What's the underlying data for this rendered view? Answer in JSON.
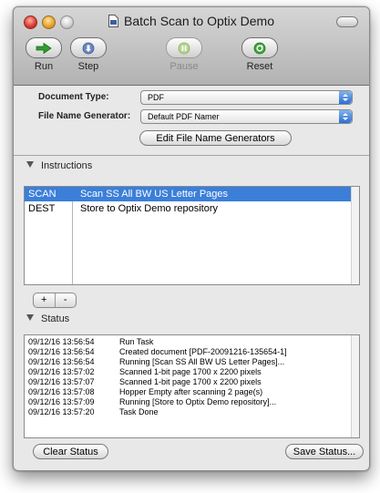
{
  "window": {
    "title": "Batch Scan to Optix Demo"
  },
  "toolbar": {
    "run": "Run",
    "step": "Step",
    "pause": "Pause",
    "reset": "Reset"
  },
  "form": {
    "document_type_label": "Document Type:",
    "document_type_value": "PDF",
    "file_name_generator_label": "File Name Generator:",
    "file_name_generator_value": "Default PDF Namer",
    "edit_generators_button": "Edit File Name Generators"
  },
  "instructions": {
    "header": "Instructions",
    "rows": [
      {
        "command": "SCAN",
        "description": "Scan SS All BW US Letter Pages",
        "selected": true
      },
      {
        "command": "DEST",
        "description": "Store to Optix Demo repository",
        "selected": false
      }
    ],
    "add_label": "+",
    "remove_label": "-"
  },
  "status": {
    "header": "Status",
    "log": [
      {
        "time": "09/12/16 13:56:54",
        "message": "Run Task"
      },
      {
        "time": "09/12/16 13:56:54",
        "message": "Created document [PDF-20091216-135654-1]"
      },
      {
        "time": "09/12/16 13:56:54",
        "message": "Running [Scan SS All BW US Letter Pages]..."
      },
      {
        "time": "09/12/16 13:57:02",
        "message": "Scanned 1-bit page 1700 x 2200 pixels"
      },
      {
        "time": "09/12/16 13:57:07",
        "message": "Scanned 1-bit page 1700 x 2200 pixels"
      },
      {
        "time": "09/12/16 13:57:08",
        "message": "Hopper Empty after scanning 2 page(s)"
      },
      {
        "time": "09/12/16 13:57:09",
        "message": "Running [Store to Optix Demo repository]..."
      },
      {
        "time": "09/12/16 13:57:20",
        "message": "Task Done"
      }
    ]
  },
  "buttons": {
    "clear_status": "Clear Status",
    "save_status": "Save Status..."
  },
  "colors": {
    "selection": "#3b7fd9",
    "run_icon": "#2e9e2e",
    "reset_icon": "#2e9e2e",
    "step_icon": "#5a78b0",
    "pause_icon": "#a7c97a"
  },
  "icons": {
    "run": "green-right-arrow-icon",
    "step": "step-icon",
    "pause": "pause-icon",
    "reset": "reset-icon"
  }
}
